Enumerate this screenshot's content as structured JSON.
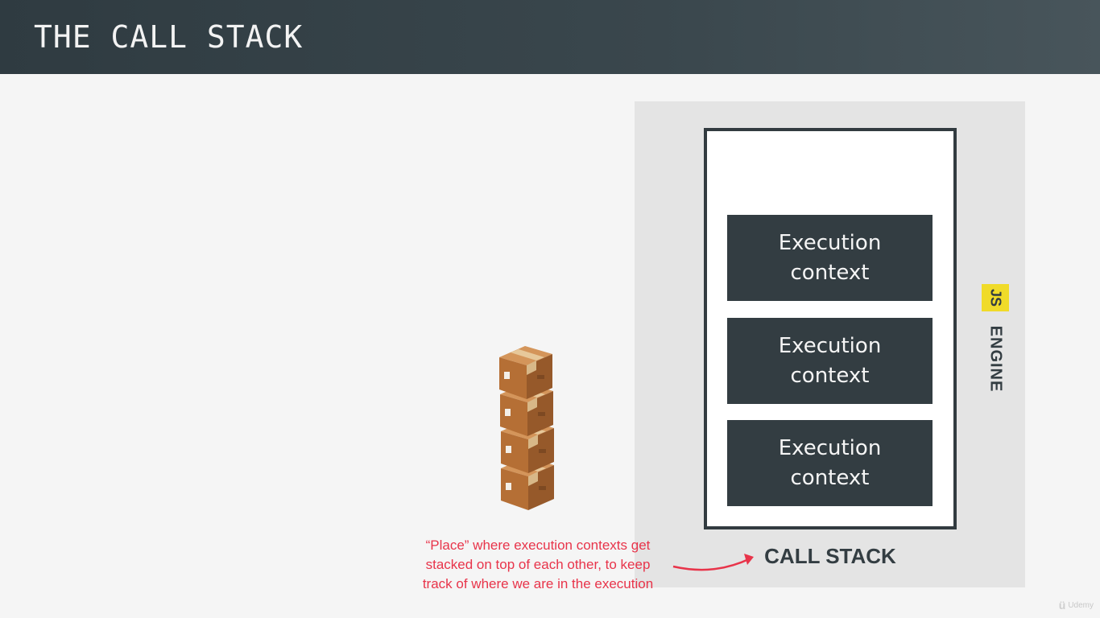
{
  "header": {
    "title": "THE CALL STACK"
  },
  "engine": {
    "js_badge": "JS",
    "label": "ENGINE"
  },
  "call_stack": {
    "label": "CALL STACK",
    "contexts": [
      {
        "line1": "Execution",
        "line2": "context"
      },
      {
        "line1": "Execution",
        "line2": "context"
      },
      {
        "line1": "Execution",
        "line2": "context"
      }
    ]
  },
  "annotation": {
    "line1": "“Place” where execution contexts get",
    "line2": "stacked on top of each other, to keep",
    "line3": "track of where we are in the execution"
  },
  "illustration": {
    "icon": "stacked-boxes-icon",
    "box_count": 4
  },
  "watermark": {
    "text": "Udemy",
    "icon": "udemy-logo-icon"
  },
  "colors": {
    "header_bg": "#333d42",
    "page_bg": "#f5f5f5",
    "panel_bg": "#e4e4e4",
    "context_bg": "#333d42",
    "js_yellow": "#f0db29",
    "annotation_red": "#e8344a"
  }
}
